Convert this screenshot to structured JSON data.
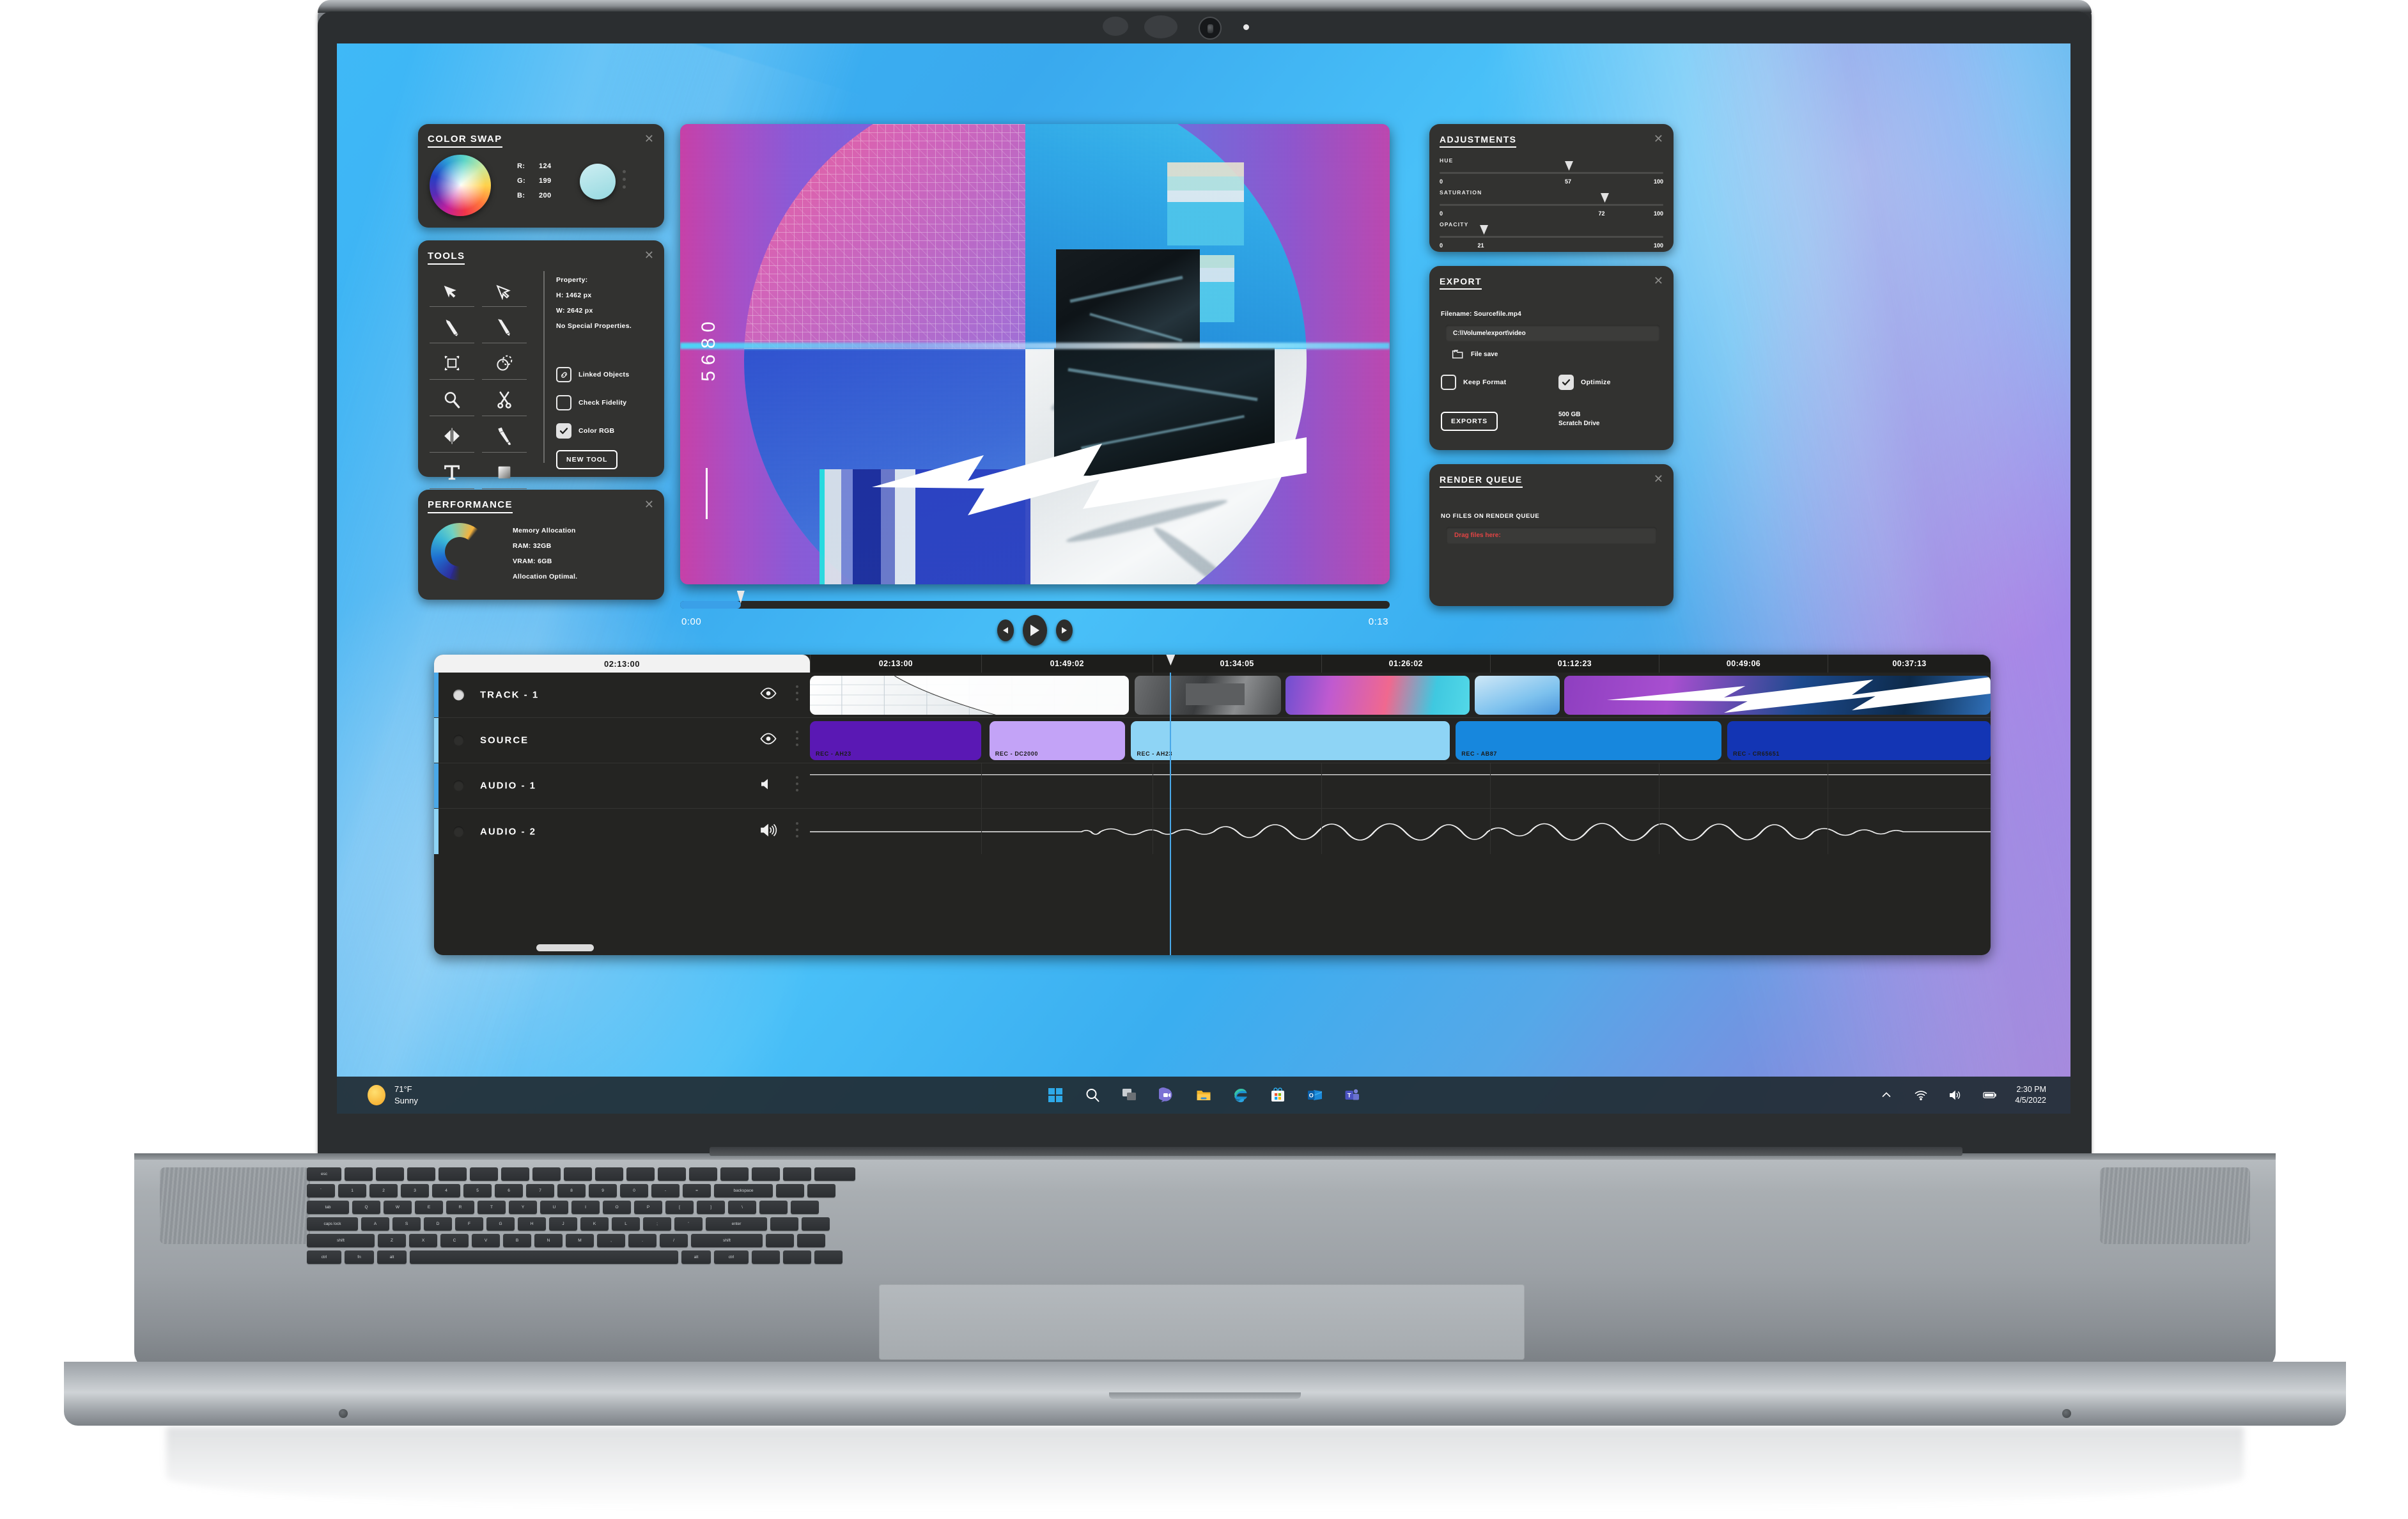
{
  "app": {
    "color_swap": {
      "title": "COLOR SWAP",
      "close": "✕",
      "r_key": "R:",
      "r_value": "124",
      "g_key": "G:",
      "g_value": "199",
      "b_key": "B:",
      "b_value": "200",
      "swatch_color": "#a9dfe6",
      "wheel_name": "color-wheel"
    },
    "tools": {
      "title": "TOOLS",
      "close": "✕",
      "items": [
        {
          "name": "cursor-arrow-icon"
        },
        {
          "name": "direct-select-arrow-icon"
        },
        {
          "name": "pencil-icon"
        },
        {
          "name": "pen-icon"
        },
        {
          "name": "crop-icon"
        },
        {
          "name": "shape-subtract-icon"
        },
        {
          "name": "zoom-magnifier-icon"
        },
        {
          "name": "scissors-icon"
        },
        {
          "name": "mirror-flip-icon"
        },
        {
          "name": "brush-icon"
        },
        {
          "name": "text-type-icon"
        },
        {
          "name": "gradient-swatch-icon"
        }
      ],
      "property_label": "Property:",
      "height_value": "H: 1462 px",
      "width_value": "W: 2642 px",
      "special": "No Special Properties.",
      "checkboxes": [
        {
          "label": "Linked Objects",
          "checked": false,
          "icon": "link-chain-icon"
        },
        {
          "label": "Check Fidelity",
          "checked": false,
          "icon": null
        },
        {
          "label": "Color RGB",
          "checked": true,
          "icon": null
        }
      ],
      "new_tool_button": "NEW TOOL"
    },
    "performance": {
      "title": "PERFORMANCE",
      "close": "✕",
      "memory_label": "Memory Allocation",
      "ram": "RAM: 32GB",
      "vram": "VRAM: 6GB",
      "status": "Allocation Optimal."
    },
    "preview": {
      "overlay_number": "5680",
      "time_current": "0:00",
      "time_total": "0:13",
      "progress_percent": 8.6,
      "controls": {
        "prev": "step-back-button",
        "play": "play-button",
        "next": "step-forward-button"
      }
    },
    "adjustments": {
      "title": "ADJUSTMENTS",
      "close": "✕",
      "sliders": [
        {
          "name": "HUE",
          "value": "57",
          "min": "0",
          "max": "100",
          "percent": 57
        },
        {
          "name": "SATURATION",
          "value": "72",
          "min": "0",
          "max": "100",
          "percent": 72
        },
        {
          "name": "OPACITY",
          "value": "21",
          "min": "0",
          "max": "100",
          "percent": 21
        }
      ]
    },
    "export": {
      "title": "EXPORT",
      "close": "✕",
      "filename": "Filename: Sourcefile.mp4",
      "path_value": "C:\\\\Volume\\export\\video",
      "file_save_label": "File save",
      "file_save_icon": "folder-icon",
      "keep_format": {
        "label": "Keep Format",
        "checked": false
      },
      "optimize": {
        "label": "Optimize",
        "checked": true
      },
      "exports_button": "EXPORTS",
      "drive_size": "500 GB",
      "drive_name": "Scratch Drive"
    },
    "render_queue": {
      "title": "RENDER QUEUE",
      "close": "✕",
      "empty_message": "NO FILES ON RENDER QUEUE",
      "drop_text": "Drag files here:",
      "drop_color": "#e24444"
    },
    "timeline": {
      "head_timecode": "02:13:00",
      "ruler_ticks": [
        "02:13:00",
        "01:49:02",
        "01:34:05",
        "01:26:02",
        "01:12:23",
        "00:49:06",
        "00:37:13"
      ],
      "playhead_percent": 30.5,
      "tracks": [
        {
          "name": "TRACK - 1",
          "icon": "eye-icon",
          "armed": true,
          "accent": "#4aa8e8"
        },
        {
          "name": "SOURCE",
          "icon": "eye-icon",
          "armed": false,
          "accent": "#8ed4f5"
        },
        {
          "name": "AUDIO - 1",
          "icon": "speaker-muted-icon",
          "armed": false,
          "accent": "#4aa8e8"
        },
        {
          "name": "AUDIO - 2",
          "icon": "speaker-loud-icon",
          "armed": false,
          "accent": "#8ed4f5"
        }
      ],
      "source_clips": [
        {
          "label": "REC - AH23",
          "color": "#5a18b4",
          "left": 0,
          "width": 14.5
        },
        {
          "label": "REC - DC2000",
          "color": "#c3a3f7",
          "left": 15.2,
          "width": 11.5
        },
        {
          "label": "REC - AH23",
          "color": "#8ed4f5",
          "left": 27.2,
          "width": 27.0
        },
        {
          "label": "REC - AB87",
          "color": "#1787dd",
          "left": 54.7,
          "width": 22.5
        },
        {
          "label": "REC - CR65651",
          "color": "#1335b4",
          "left": 77.7,
          "width": 22.3
        }
      ]
    }
  },
  "taskbar": {
    "weather_temp": "71°F",
    "weather_condition": "Sunny",
    "icons": [
      {
        "name": "start-windows-icon"
      },
      {
        "name": "search-icon"
      },
      {
        "name": "task-view-icon"
      },
      {
        "name": "chat-icon"
      },
      {
        "name": "file-explorer-icon"
      },
      {
        "name": "edge-browser-icon"
      },
      {
        "name": "microsoft-store-icon"
      },
      {
        "name": "outlook-icon"
      },
      {
        "name": "teams-icon"
      }
    ],
    "tray": [
      {
        "name": "show-hidden-icons-chevron"
      },
      {
        "name": "wifi-icon"
      },
      {
        "name": "volume-icon"
      },
      {
        "name": "battery-icon"
      }
    ],
    "clock_time": "2:30 PM",
    "clock_date": "4/5/2022"
  },
  "keyboard": {
    "rows": [
      [
        "esc",
        "",
        "",
        "",
        "",
        "",
        "",
        "",
        "",
        "",
        "",
        "",
        "",
        "",
        "",
        "",
        ""
      ],
      [
        "`",
        "1",
        "2",
        "3",
        "4",
        "5",
        "6",
        "7",
        "8",
        "9",
        "0",
        "-",
        "=",
        "backspace"
      ],
      [
        "tab",
        "Q",
        "W",
        "E",
        "R",
        "T",
        "Y",
        "U",
        "I",
        "O",
        "P",
        "[",
        "]",
        "\\"
      ],
      [
        "caps lock",
        "A",
        "S",
        "D",
        "F",
        "G",
        "H",
        "J",
        "K",
        "L",
        ";",
        "'",
        "enter"
      ],
      [
        "shift",
        "Z",
        "X",
        "C",
        "V",
        "B",
        "N",
        "M",
        ",",
        ".",
        "/",
        "shift"
      ],
      [
        "ctrl",
        "fn",
        "alt",
        "",
        "alt",
        "ctrl",
        "",
        "",
        ""
      ]
    ]
  }
}
